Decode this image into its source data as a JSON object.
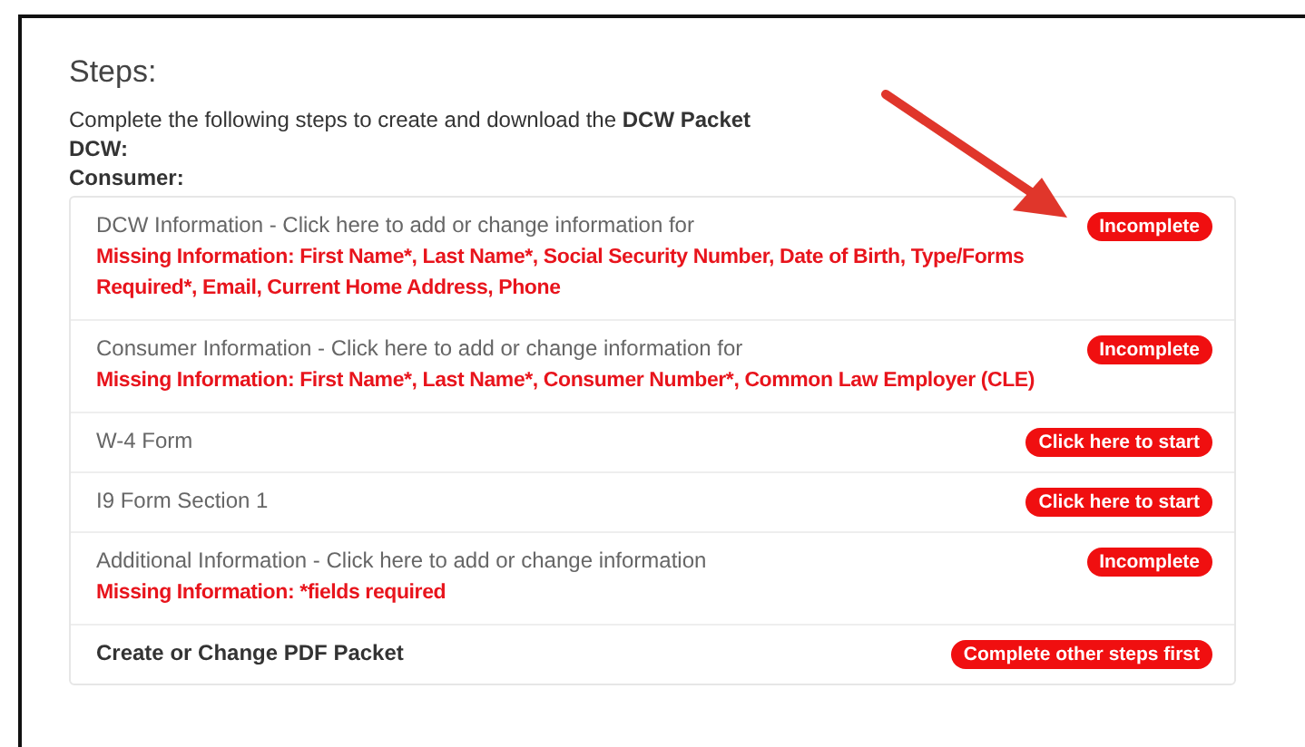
{
  "heading": "Steps:",
  "intro": "Complete the following steps to create and download the **DCW Packet**",
  "labels": [
    "DCW:",
    "Consumer:"
  ],
  "steps": [
    {
      "title": "DCW Information - Click here to add or change information for",
      "emphasized": false,
      "missing": "Missing Information: First Name*, Last Name*, Social Security Number, Date of Birth, Type/Forms Required*, Email, Current Home Address, Phone",
      "status": "Incomplete"
    },
    {
      "title": "Consumer Information - Click here to add or change information for",
      "emphasized": false,
      "missing": "Missing Information: First Name*, Last Name*, Consumer Number*, Common Law Employer (CLE)",
      "status": "Incomplete"
    },
    {
      "title": "W-4 Form",
      "emphasized": false,
      "status": "Click here to start"
    },
    {
      "title": "I9 Form Section 1",
      "emphasized": false,
      "status": "Click here to start"
    },
    {
      "title": "Additional Information - Click here to add or change information",
      "emphasized": false,
      "missing": "Missing Information: *fields required",
      "status": "Incomplete"
    },
    {
      "title": "Create or Change PDF Packet",
      "emphasized": true,
      "status": "Complete other steps first"
    }
  ]
}
